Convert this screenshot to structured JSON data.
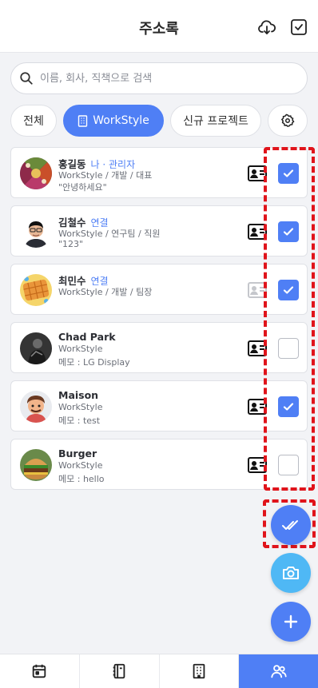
{
  "header": {
    "title": "주소록",
    "cloud_icon": "cloud-download-icon",
    "check_icon": "checkbox-icon"
  },
  "search": {
    "placeholder": "이름, 회사, 직책으로 검색",
    "value": ""
  },
  "chips": [
    {
      "label": "전체",
      "active": false
    },
    {
      "label": "WorkStyle",
      "active": true,
      "icon": "building-icon"
    },
    {
      "label": "신규 프로젝트",
      "active": false
    },
    {
      "label": "",
      "icon": "gear-icon"
    }
  ],
  "contacts": [
    {
      "name": "홍길동",
      "tag": "나 · 관리자",
      "line2": "WorkStyle / 개발 / 대표",
      "line3": "\"안녕하세요\"",
      "checked": true,
      "card_active": true,
      "avatar": "avatar-pattern"
    },
    {
      "name": "김철수",
      "tag": "연결",
      "line2": "WorkStyle / 연구팀 / 직원",
      "line3": "\"123\"",
      "checked": true,
      "card_active": true,
      "avatar": "avatar-man-glasses"
    },
    {
      "name": "최민수",
      "tag": "연결",
      "line2": "WorkStyle / 개발 / 팀장",
      "line3": "",
      "checked": true,
      "card_active": false,
      "avatar": "avatar-waffle"
    },
    {
      "name": "Chad Park",
      "tag": "",
      "line2": "WorkStyle",
      "line3": "메모 : LG Display",
      "checked": false,
      "card_active": true,
      "avatar": "avatar-dark-photo"
    },
    {
      "name": "Maison",
      "tag": "",
      "line2": "WorkStyle",
      "line3": "메모 : test",
      "checked": true,
      "card_active": true,
      "avatar": "avatar-cartoon"
    },
    {
      "name": "Burger",
      "tag": "",
      "line2": "WorkStyle",
      "line3": "메모 : hello",
      "checked": false,
      "card_active": true,
      "avatar": "avatar-burger"
    }
  ],
  "fabs": [
    {
      "icon": "double-check-icon",
      "color": "#4f7ff5"
    },
    {
      "icon": "camera-icon",
      "color": "#4fb8f5"
    },
    {
      "icon": "plus-icon",
      "color": "#4f7ff5"
    }
  ],
  "bottom_nav": [
    {
      "icon": "calendar-icon",
      "active": false
    },
    {
      "icon": "notebook-icon",
      "active": false
    },
    {
      "icon": "building-icon",
      "active": false
    },
    {
      "icon": "people-icon",
      "active": true
    }
  ],
  "colors": {
    "accent": "#4f7ff5",
    "camera": "#4fb8f5",
    "highlight": "#e0141b"
  }
}
